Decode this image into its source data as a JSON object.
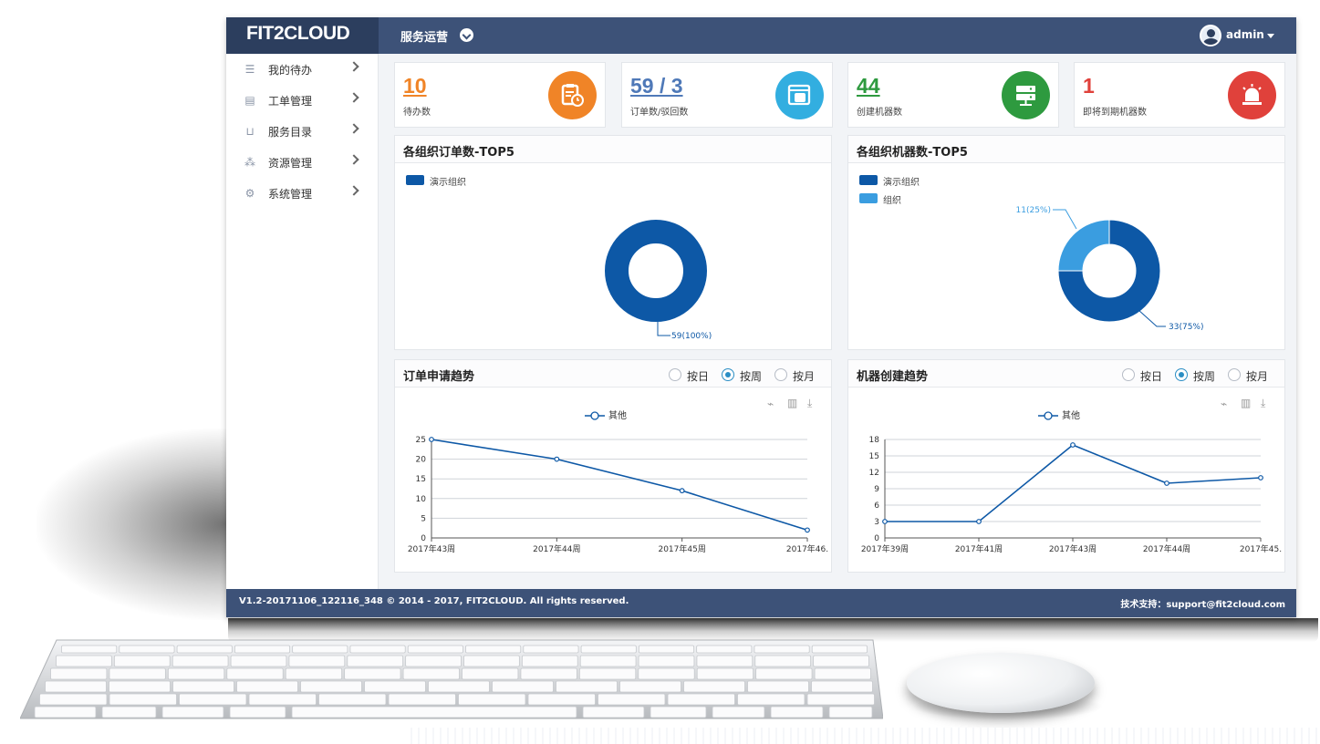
{
  "header": {
    "logo": "FIT2CLOUD",
    "menu_title": "服务运营",
    "username": "admin"
  },
  "sidebar": {
    "items": [
      {
        "label": "我的待办",
        "icon": "list-icon"
      },
      {
        "label": "工单管理",
        "icon": "document-icon"
      },
      {
        "label": "服务目录",
        "icon": "cart-icon"
      },
      {
        "label": "资源管理",
        "icon": "cubes-icon"
      },
      {
        "label": "系统管理",
        "icon": "gears-icon"
      }
    ]
  },
  "stats": [
    {
      "value": "10",
      "label": "待办数",
      "color": "#f08427",
      "circle": "#f08427",
      "icon": "clipboard-clock-icon"
    },
    {
      "value": "59 / 3",
      "label": "订单数/驳回数",
      "color": "#4f79b8",
      "circle": "#32aee0",
      "icon": "server-window-icon"
    },
    {
      "value": "44",
      "label": "创建机器数",
      "color": "#2e9a3f",
      "circle": "#2e9a3f",
      "icon": "server-rack-icon"
    },
    {
      "value": "1",
      "label": "即将到期机器数",
      "color": "#e0413b",
      "circle": "#e0413b",
      "icon": "alarm-light-icon"
    }
  ],
  "panels": {
    "orders_top5": {
      "title": "各组织订单数-TOP5",
      "legend": [
        "演示组织"
      ]
    },
    "machines_top5": {
      "title": "各组织机器数-TOP5",
      "legend": [
        "演示组织",
        "组织"
      ]
    },
    "order_trend": {
      "title": "订单申请趋势",
      "radios": [
        "按日",
        "按周",
        "按月"
      ],
      "selected": "按周",
      "legend": "其他"
    },
    "machine_trend": {
      "title": "机器创建趋势",
      "radios": [
        "按日",
        "按周",
        "按月"
      ],
      "selected": "按周",
      "legend": "其他"
    }
  },
  "footer": {
    "left": "V1.2-20171106_122116_348 © 2014 - 2017, FIT2CLOUD. All rights reserved.",
    "right": "技术支持：support@fit2cloud.com"
  },
  "colors": {
    "topbar": "#3d5278",
    "dark_blue": "#0d58a6",
    "light_blue": "#3a9de0"
  },
  "chart_data": [
    {
      "type": "pie",
      "title": "各组织订单数-TOP5",
      "labels": [
        "演示组织"
      ],
      "values": [
        59
      ],
      "data_labels": [
        "59(100%)"
      ],
      "donut": true
    },
    {
      "type": "pie",
      "title": "各组织机器数-TOP5",
      "labels": [
        "演示组织",
        "组织"
      ],
      "values": [
        33,
        11
      ],
      "data_labels": [
        "33(75%)",
        "11(25%)"
      ],
      "donut": true
    },
    {
      "type": "line",
      "title": "订单申请趋势",
      "categories": [
        "2017年43周",
        "2017年44周",
        "2017年45周",
        "2017年46."
      ],
      "series": [
        {
          "name": "其他",
          "values": [
            25,
            20,
            12,
            2
          ]
        }
      ],
      "ylim": [
        0,
        25
      ],
      "yticks": [
        0,
        5,
        10,
        15,
        20,
        25
      ],
      "grid": true,
      "legend": "top-center"
    },
    {
      "type": "line",
      "title": "机器创建趋势",
      "categories": [
        "2017年39周",
        "2017年41周",
        "2017年43周",
        "2017年44周",
        "2017年45."
      ],
      "series": [
        {
          "name": "其他",
          "values": [
            3,
            3,
            17,
            10,
            11
          ]
        }
      ],
      "ylim": [
        0,
        18
      ],
      "yticks": [
        0,
        3,
        6,
        9,
        12,
        15,
        18
      ],
      "grid": true,
      "legend": "top-center"
    }
  ]
}
